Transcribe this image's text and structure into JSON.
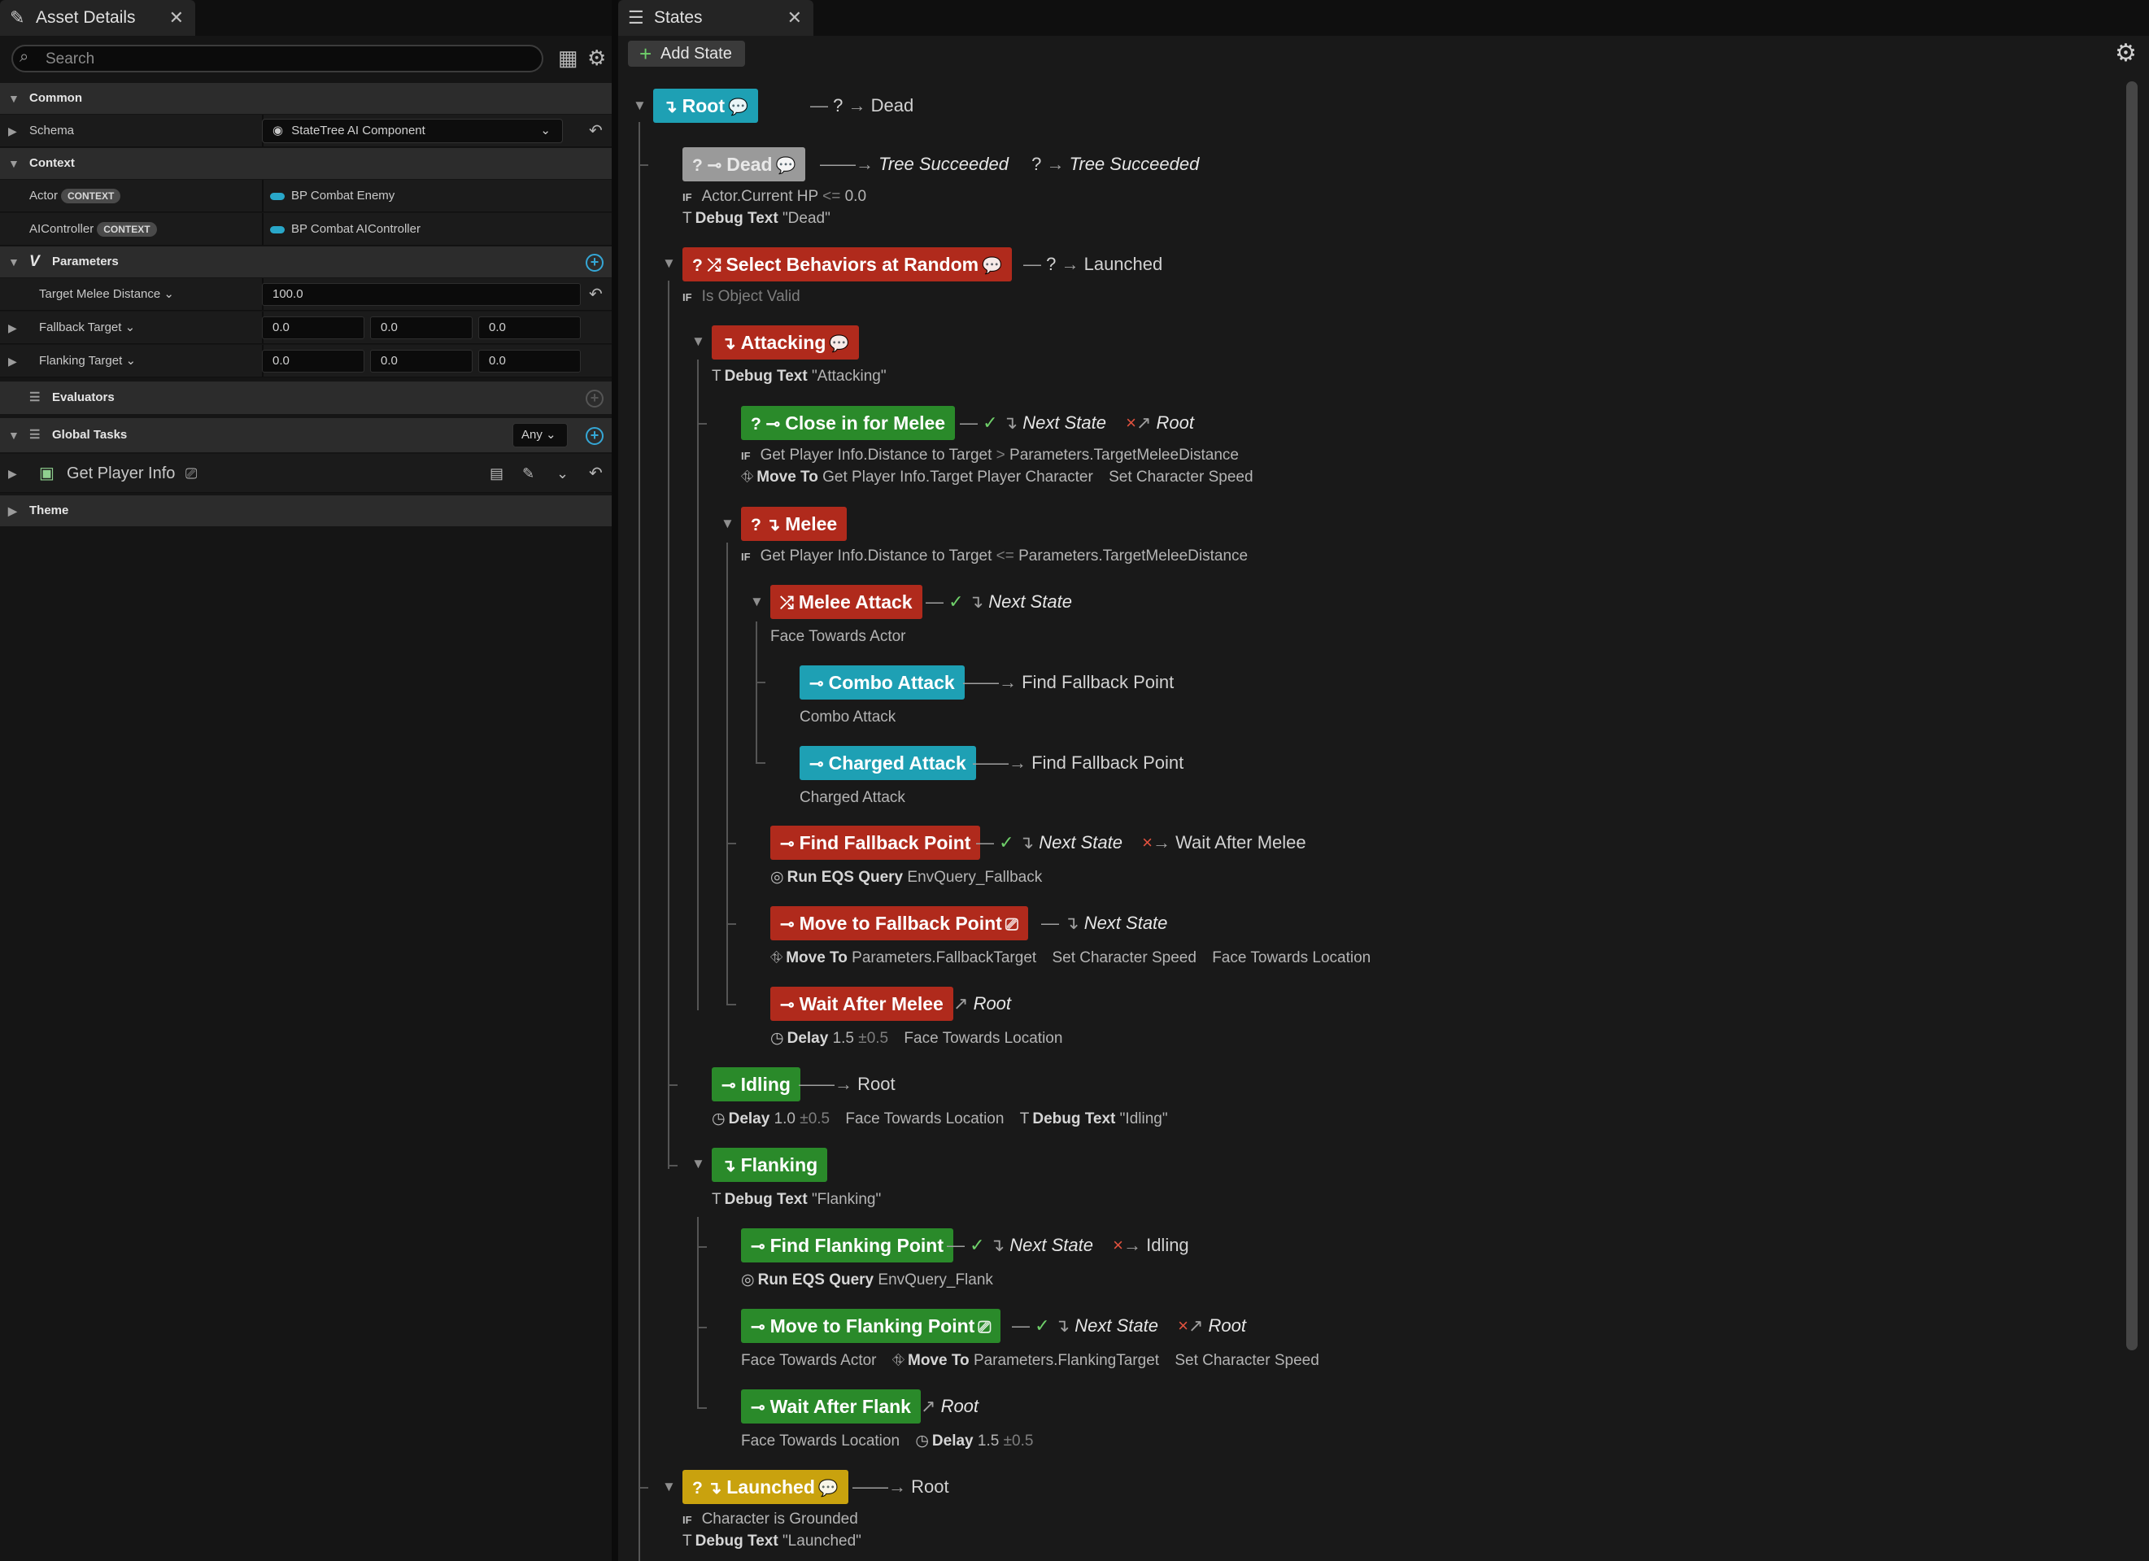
{
  "left_panel": {
    "tab_title": "Asset Details",
    "search_placeholder": "Search",
    "sections": {
      "common": "Common",
      "context": "Context",
      "parameters": "Parameters",
      "evaluators": "Evaluators",
      "global_tasks": "Global Tasks",
      "theme": "Theme"
    },
    "schema": {
      "label": "Schema",
      "value": "StateTree AI Component"
    },
    "context_rows": [
      {
        "label": "Actor",
        "badge": "CONTEXT",
        "value": "BP Combat Enemy"
      },
      {
        "label": "AIController",
        "badge": "CONTEXT",
        "value": "BP Combat AIController"
      }
    ],
    "params": {
      "target_melee_distance": {
        "label": "Target Melee Distance",
        "value": "100.0"
      },
      "fallback_target": {
        "label": "Fallback Target",
        "x": "0.0",
        "y": "0.0",
        "z": "0.0"
      },
      "flanking_target": {
        "label": "Flanking Target",
        "x": "0.0",
        "y": "0.0",
        "z": "0.0"
      }
    },
    "global_tasks_any": "Any",
    "global_task_item": "Get Player Info"
  },
  "right_panel": {
    "tab_title": "States",
    "add_state_label": "Add State",
    "states": {
      "root": {
        "name": "Root",
        "transition": "Dead"
      },
      "dead": {
        "name": "Dead",
        "t1": "Tree Succeeded",
        "t2": "Tree Succeeded",
        "cond_prefix": "Actor.Current HP",
        "cond_op": "<=",
        "cond_value": "0.0",
        "task": "Debug Text",
        "task_arg": "\"Dead\""
      },
      "select": {
        "name": "Select Behaviors at Random",
        "transition": "Launched",
        "cond": "Is Object Valid"
      },
      "attacking": {
        "name": "Attacking",
        "task": "Debug Text",
        "task_arg": "\"Attacking\""
      },
      "close_in": {
        "name": "Close in for Melee",
        "t_success": "Next State",
        "t_fail": "Root",
        "cond_left": "Get Player Info.Distance to Target",
        "cond_op": ">",
        "cond_right": "Parameters.TargetMeleeDistance",
        "task": "Move To",
        "task_arg": "Get Player Info.Target Player Character",
        "task2": "Set Character Speed"
      },
      "melee": {
        "name": "Melee",
        "cond_left": "Get Player Info.Distance to Target",
        "cond_op": "<=",
        "cond_right": "Parameters.TargetMeleeDistance"
      },
      "melee_attack": {
        "name": "Melee Attack",
        "transition": "Next State",
        "task": "Face Towards Actor"
      },
      "combo": {
        "name": "Combo Attack",
        "transition": "Find Fallback Point",
        "task": "Combo Attack"
      },
      "charged": {
        "name": "Charged Attack",
        "transition": "Find Fallback Point",
        "task": "Charged Attack"
      },
      "find_fallback": {
        "name": "Find Fallback Point",
        "t_success": "Next State",
        "t_fail": "Wait After Melee",
        "task": "Run EQS Query",
        "task_arg": "EnvQuery_Fallback"
      },
      "move_fallback": {
        "name": "Move to Fallback Point",
        "transition": "Next State",
        "task": "Move To",
        "task_arg": "Parameters.FallbackTarget",
        "task2": "Set Character Speed",
        "task3": "Face Towards Location"
      },
      "wait_melee": {
        "name": "Wait After Melee",
        "transition": "Root",
        "task": "Delay",
        "delay": "1.5",
        "delay_var": "±0.5",
        "task2": "Face Towards Location"
      },
      "idling": {
        "name": "Idling",
        "transition": "Root",
        "task": "Delay",
        "delay": "1.0",
        "delay_var": "±0.5",
        "task2": "Face Towards Location",
        "task3": "Debug Text",
        "task3_arg": "\"Idling\""
      },
      "flanking": {
        "name": "Flanking",
        "task": "Debug Text",
        "task_arg": "\"Flanking\""
      },
      "find_flank": {
        "name": "Find Flanking Point",
        "t_success": "Next State",
        "t_fail": "Idling",
        "task": "Run EQS Query",
        "task_arg": "EnvQuery_Flank"
      },
      "move_flank": {
        "name": "Move to Flanking Point",
        "t_success": "Next State",
        "t_fail": "Root",
        "task1": "Face Towards Actor",
        "task": "Move To",
        "task_arg": "Parameters.FlankingTarget",
        "task2": "Set Character Speed"
      },
      "wait_flank": {
        "name": "Wait After Flank",
        "transition": "Root",
        "task1": "Face Towards Location",
        "task": "Delay",
        "delay": "1.5",
        "delay_var": "±0.5"
      },
      "launched": {
        "name": "Launched",
        "transition": "Root",
        "cond": "Character is Grounded",
        "task": "Debug Text",
        "task_arg": "\"Launched\""
      }
    }
  },
  "colors": {
    "state_red": "#b02a1c",
    "state_teal": "#1ea0b4",
    "state_green": "#2a8a2a",
    "state_grey": "#9a9a9a",
    "state_yellow": "#c9a20e",
    "accent_blue": "#35a7d6"
  },
  "icons": [
    "search-icon",
    "gear-icon",
    "close-icon",
    "table-icon",
    "plus-icon",
    "comment-icon",
    "check-icon",
    "fail-icon",
    "clock-icon",
    "eqs-icon",
    "move-to-icon",
    "text-icon",
    "reset-icon"
  ]
}
